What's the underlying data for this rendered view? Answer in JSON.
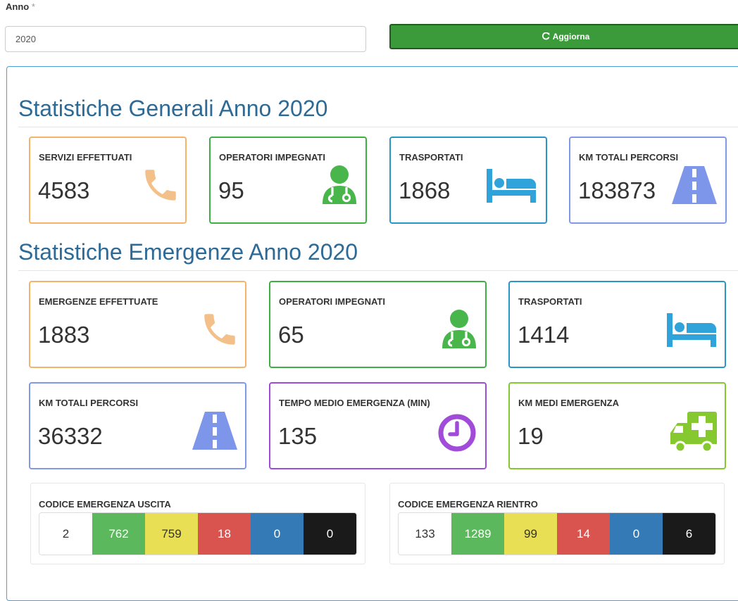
{
  "form": {
    "year_label": "Anno",
    "required_mark": "*",
    "year_value": "2020",
    "refresh_label": "Aggiorna",
    "refresh_icon": "refresh-icon"
  },
  "general": {
    "title": "Statistiche Generali Anno 2020",
    "cards": [
      {
        "label": "SERVIZI EFFETTUATI",
        "value": "4583",
        "icon": "phone-icon",
        "color": "#f4b36b"
      },
      {
        "label": "OPERATORI IMPEGNATI",
        "value": "95",
        "icon": "doctor-icon",
        "color": "#3fae43"
      },
      {
        "label": "TRASPORTATI",
        "value": "1868",
        "icon": "bed-icon",
        "color": "#2a95c9"
      },
      {
        "label": "KM TOTALI PERCORSI",
        "value": "183873",
        "icon": "road-icon",
        "color": "#7f99e8"
      }
    ]
  },
  "emergency": {
    "title": "Statistiche Emergenze Anno 2020",
    "cards": [
      {
        "label": "EMERGENZE EFFETTUATE",
        "value": "1883",
        "icon": "phone-icon",
        "color": "#f4b36b"
      },
      {
        "label": "OPERATORI IMPEGNATI",
        "value": "65",
        "icon": "doctor-icon",
        "color": "#3fae43"
      },
      {
        "label": "TRASPORTATI",
        "value": "1414",
        "icon": "bed-icon",
        "color": "#2a95c9"
      },
      {
        "label": "KM TOTALI PERCORSI",
        "value": "36332",
        "icon": "road-icon",
        "color": "#7f99e8"
      },
      {
        "label": "TEMPO MEDIO EMERGENZA (min)",
        "value": "135",
        "icon": "clock-icon",
        "color": "#a14bd9"
      },
      {
        "label": "KM MEDI EMERGENZA",
        "value": "19",
        "icon": "ambulance-icon",
        "color": "#86c830"
      }
    ]
  },
  "codes": {
    "exit": {
      "title": "CODICE EMERGENZA USCITA",
      "values": [
        "2",
        "762",
        "759",
        "18",
        "0",
        "0"
      ]
    },
    "return": {
      "title": "CODICE EMERGENZA RIENTRO",
      "values": [
        "133",
        "1289",
        "99",
        "14",
        "0",
        "6"
      ]
    },
    "colors": [
      "#ffffff",
      "#5cb85c",
      "#e8df55",
      "#d9534f",
      "#337ab7",
      "#1a1a1a"
    ],
    "text_colors": [
      "#333333",
      "#ffffff",
      "#333333",
      "#ffffff",
      "#ffffff",
      "#ffffff"
    ]
  }
}
